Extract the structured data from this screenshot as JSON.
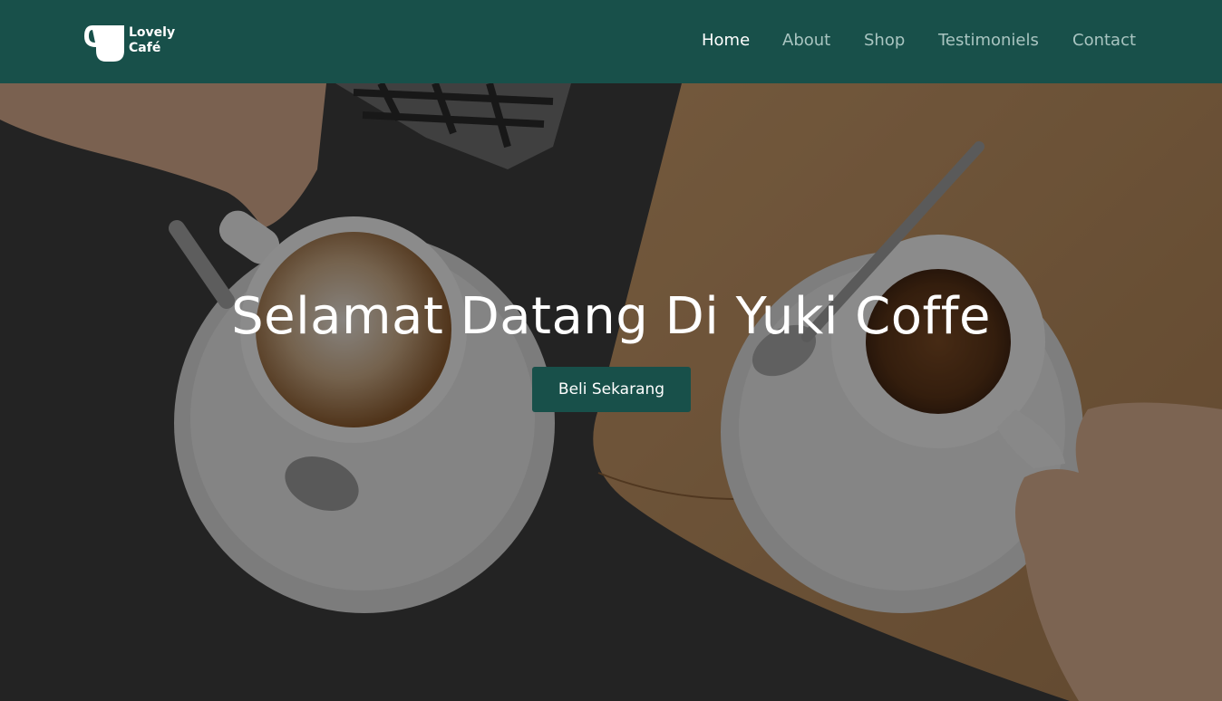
{
  "brand": {
    "line1": "Lovely",
    "line2": "Café",
    "icon": "coffee-mug-icon"
  },
  "nav": {
    "items": [
      {
        "label": "Home",
        "active": true
      },
      {
        "label": "About",
        "active": false
      },
      {
        "label": "Shop",
        "active": false
      },
      {
        "label": "Testimoniels",
        "active": false
      },
      {
        "label": "Contact",
        "active": false
      }
    ]
  },
  "hero": {
    "title": "Selamat Datang Di Yuki Coffe",
    "cta_label": "Beli Sekarang"
  },
  "colors": {
    "primary": "#18504a",
    "nav_inactive": "#a9c5c1",
    "text_light": "#ffffff"
  }
}
